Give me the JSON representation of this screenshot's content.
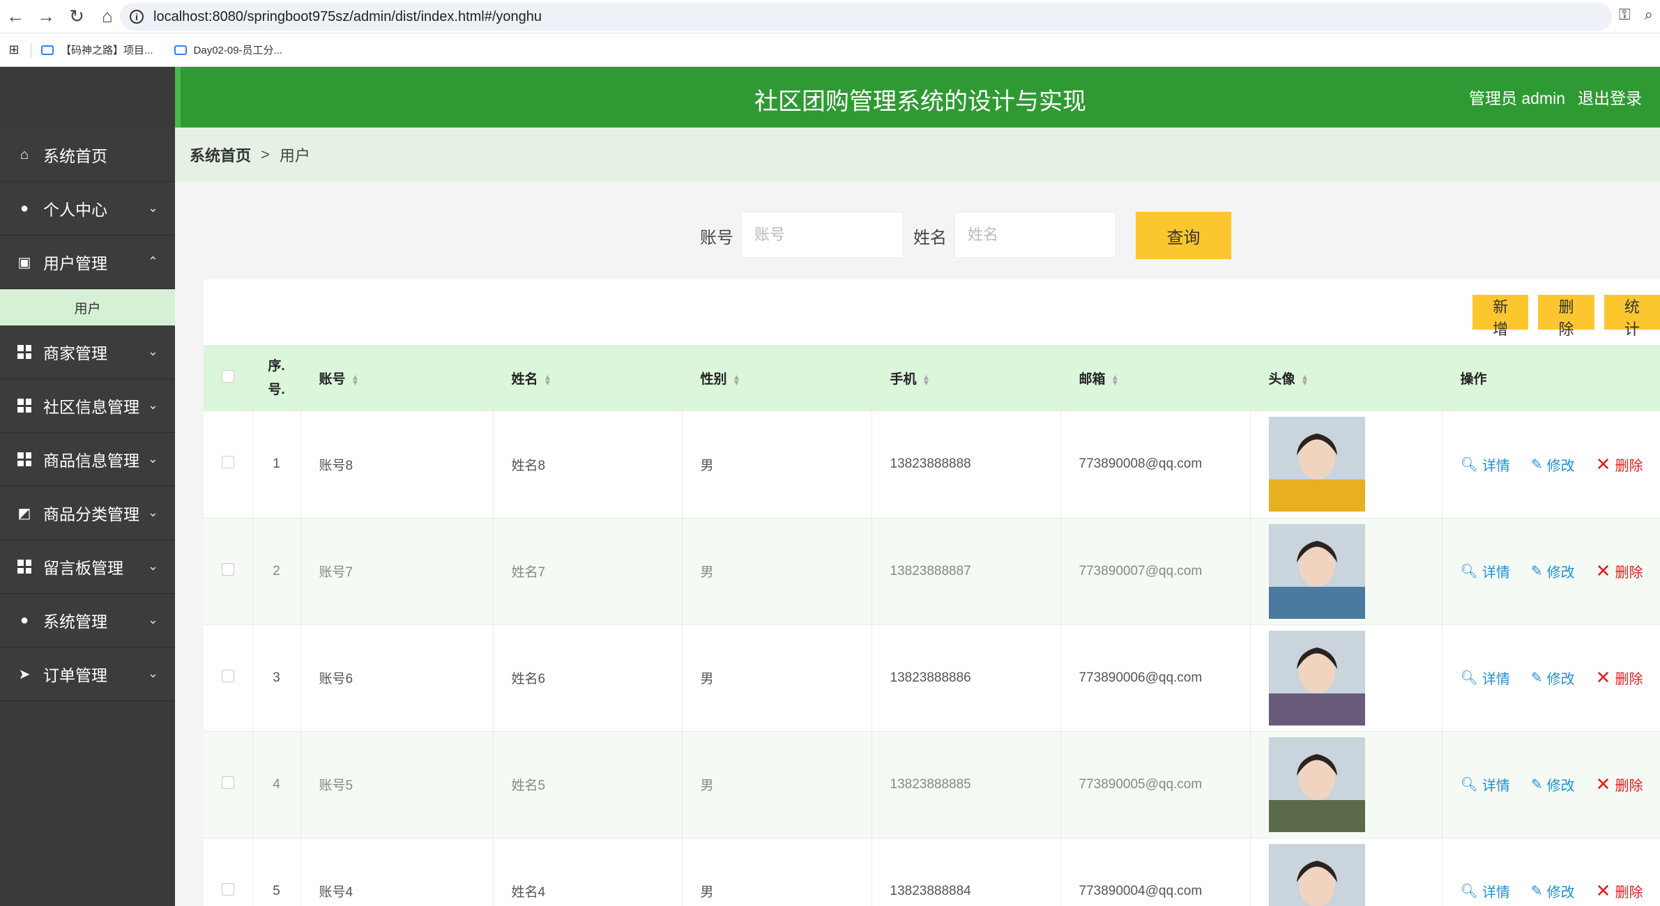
{
  "browser": {
    "url": "localhost:8080/springboot975sz/admin/dist/index.html#/yonghu",
    "bookmarks": [
      "【码神之路】项目...",
      "Day02-09-员工分..."
    ]
  },
  "header": {
    "title": "社区团购管理系统的设计与实现",
    "user_label": "管理员 admin",
    "logout_label": "退出登录"
  },
  "sidebar": {
    "items": [
      {
        "label": "系统首页",
        "icon": "home-icon"
      },
      {
        "label": "个人中心",
        "icon": "user-icon"
      },
      {
        "label": "用户管理",
        "icon": "clipboard-icon"
      },
      {
        "label": "商家管理",
        "icon": "grid-icon"
      },
      {
        "label": "社区信息管理",
        "icon": "grid-icon"
      },
      {
        "label": "商品信息管理",
        "icon": "grid-icon"
      },
      {
        "label": "商品分类管理",
        "icon": "chart-icon"
      },
      {
        "label": "留言板管理",
        "icon": "grid-icon"
      },
      {
        "label": "系统管理",
        "icon": "bulb-icon"
      },
      {
        "label": "订单管理",
        "icon": "send-icon"
      }
    ],
    "sub_item": "用户"
  },
  "breadcrumb": {
    "home": "系统首页",
    "separator": ">",
    "current": "用户"
  },
  "search": {
    "account_label": "账号",
    "account_placeholder": "账号",
    "name_label": "姓名",
    "name_placeholder": "姓名",
    "query_label": "查询"
  },
  "actions": {
    "add": "新增",
    "delete": "删除",
    "stats": "统计"
  },
  "table": {
    "columns": [
      "序.号.",
      "账号",
      "姓名",
      "性别",
      "手机",
      "邮箱",
      "头像",
      "操作"
    ],
    "rows": [
      {
        "index": "1",
        "account": "账号8",
        "name": "姓名8",
        "gender": "男",
        "phone": "13823888888",
        "email": "773890008@qq.com",
        "avatar_color": "#e8b020"
      },
      {
        "index": "2",
        "account": "账号7",
        "name": "姓名7",
        "gender": "男",
        "phone": "13823888887",
        "email": "773890007@qq.com",
        "avatar_color": "#4a7aa0"
      },
      {
        "index": "3",
        "account": "账号6",
        "name": "姓名6",
        "gender": "男",
        "phone": "13823888886",
        "email": "773890006@qq.com",
        "avatar_color": "#6a5a7a"
      },
      {
        "index": "4",
        "account": "账号5",
        "name": "姓名5",
        "gender": "男",
        "phone": "13823888885",
        "email": "773890005@qq.com",
        "avatar_color": "#5a6a4a"
      },
      {
        "index": "5",
        "account": "账号4",
        "name": "姓名4",
        "gender": "男",
        "phone": "13823888884",
        "email": "773890004@qq.com",
        "avatar_color": "#8a6a5a"
      }
    ],
    "op_detail": "详情",
    "op_edit": "修改",
    "op_delete": "删除"
  }
}
